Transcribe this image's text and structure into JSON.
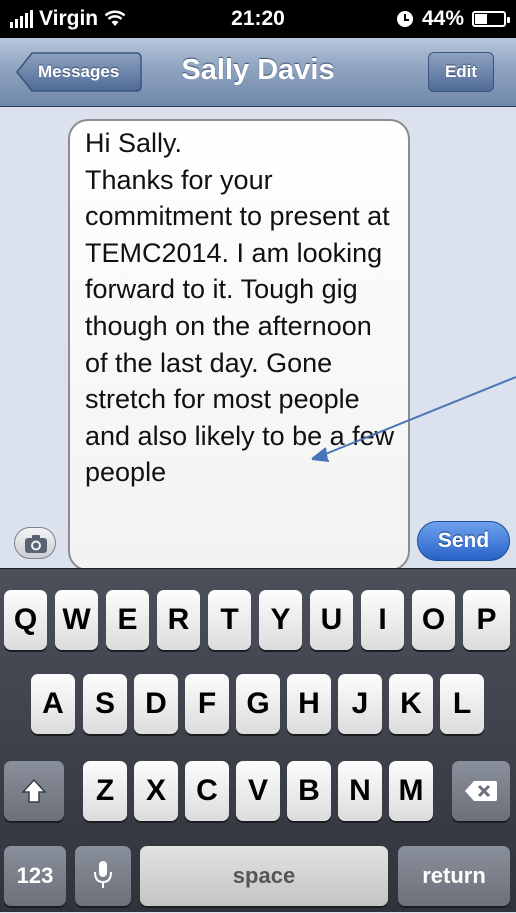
{
  "status": {
    "carrier": "Virgin",
    "time": "21:20",
    "battery": "44%",
    "battery_level": 0.44
  },
  "nav": {
    "back_label": "Messages",
    "title": "Sally Davis",
    "edit_label": "Edit"
  },
  "message": {
    "text": "Hi Sally.\nThanks for your commitment to present at TEMC2014. I am looking forward to it. Tough gig though on the afternoon of the last day. Gone stretch for most people and also likely to be a few people"
  },
  "composer": {
    "send_label": "Send"
  },
  "keyboard": {
    "row1": [
      "Q",
      "W",
      "E",
      "R",
      "T",
      "Y",
      "U",
      "I",
      "O",
      "P"
    ],
    "row2": [
      "A",
      "S",
      "D",
      "F",
      "G",
      "H",
      "J",
      "K",
      "L"
    ],
    "row3": [
      "Z",
      "X",
      "C",
      "V",
      "B",
      "N",
      "M"
    ],
    "numbers_label": "123",
    "space_label": "space",
    "return_label": "return"
  },
  "colors": {
    "nav_blue": "#6f87a9",
    "send_blue": "#2862c7",
    "arrow": "#4a74b8"
  }
}
